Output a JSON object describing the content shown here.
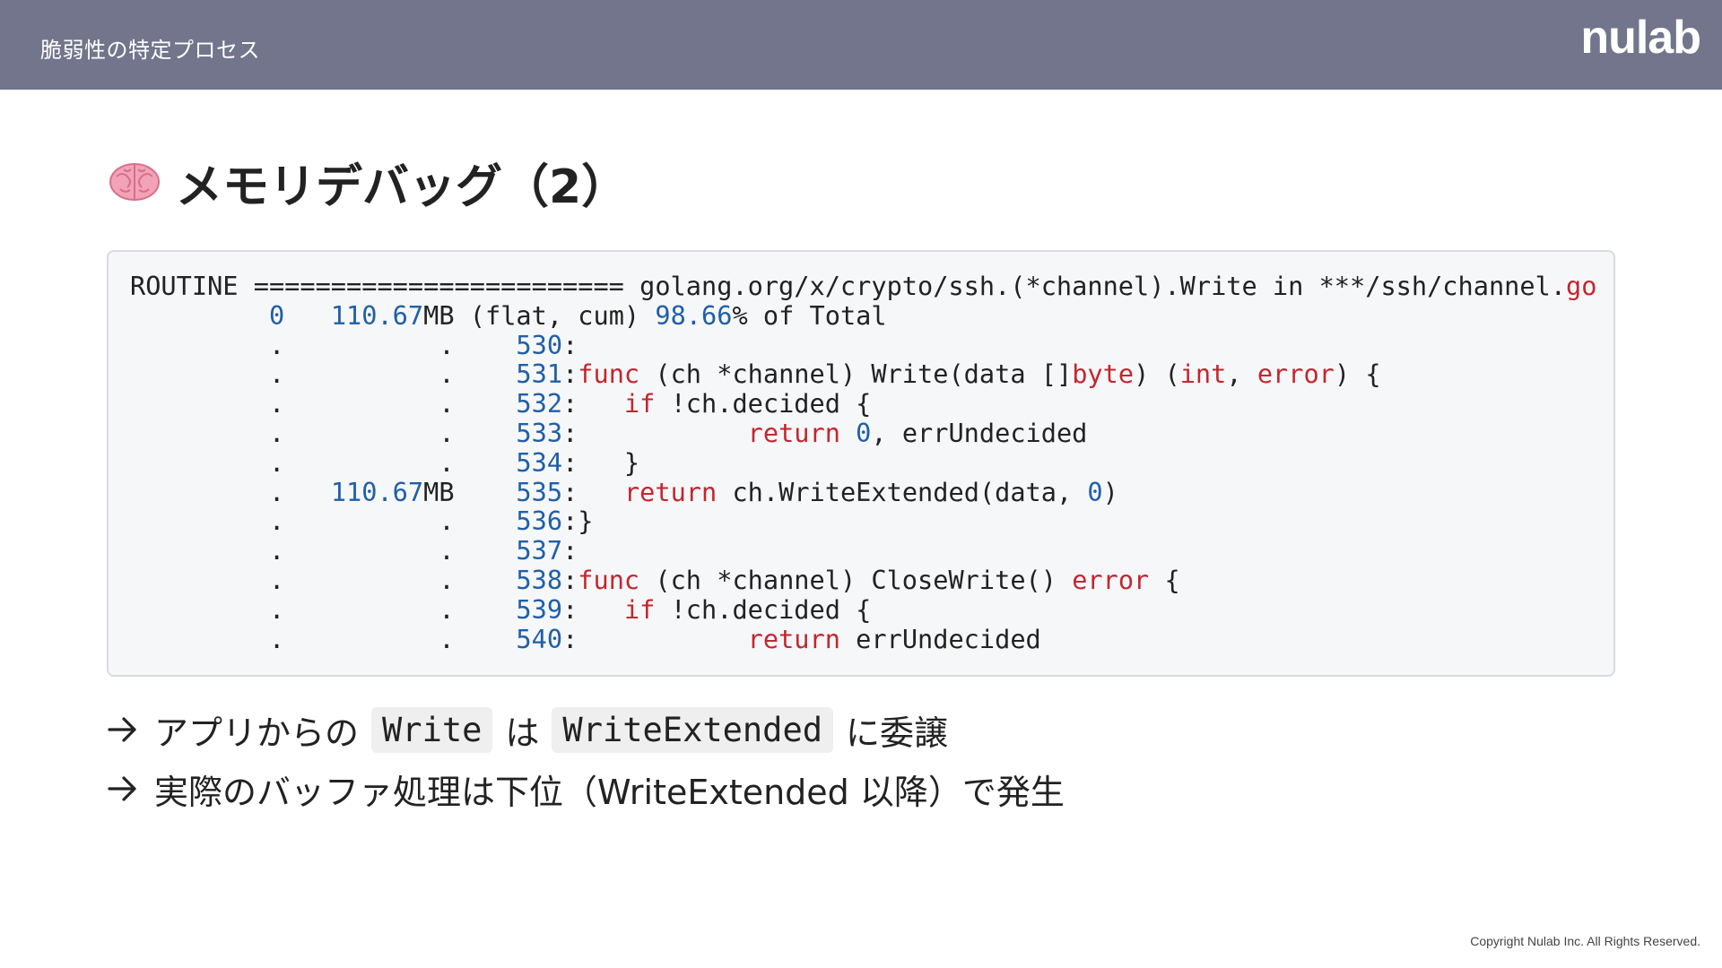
{
  "header": {
    "section_title": "脆弱性の特定プロセス",
    "logo_text": "nulab"
  },
  "title": {
    "icon": "brain-icon",
    "text": "メモリデバッグ（2）"
  },
  "code": {
    "routine": {
      "label": "ROUTINE",
      "separator": "========================",
      "path": "golang.org/x/crypto/ssh.(*channel).Write in ***/ssh/channel.",
      "ext": "go"
    },
    "summary": {
      "flat": "0",
      "cum_value": "110.67",
      "cum_unit": "MB",
      "label": "(flat, cum)",
      "percent": "98.66",
      "percent_suffix": "% of Total"
    },
    "lines": [
      {
        "flat": ".",
        "cum": ".",
        "cum_unit": "",
        "num": "530",
        "segments": []
      },
      {
        "flat": ".",
        "cum": ".",
        "cum_unit": "",
        "num": "531",
        "segments": [
          {
            "t": "func",
            "c": "k"
          },
          {
            "t": " (ch *channel) Write(data []",
            "c": ""
          },
          {
            "t": "byte",
            "c": "k"
          },
          {
            "t": ") (",
            "c": ""
          },
          {
            "t": "int",
            "c": "k"
          },
          {
            "t": ", ",
            "c": ""
          },
          {
            "t": "error",
            "c": "k"
          },
          {
            "t": ") {",
            "c": ""
          }
        ]
      },
      {
        "flat": ".",
        "cum": ".",
        "cum_unit": "",
        "num": "532",
        "segments": [
          {
            "t": "   ",
            "c": ""
          },
          {
            "t": "if",
            "c": "k"
          },
          {
            "t": " !ch.decided {",
            "c": ""
          }
        ]
      },
      {
        "flat": ".",
        "cum": ".",
        "cum_unit": "",
        "num": "533",
        "segments": [
          {
            "t": "           ",
            "c": ""
          },
          {
            "t": "return",
            "c": "k"
          },
          {
            "t": " ",
            "c": ""
          },
          {
            "t": "0",
            "c": "n"
          },
          {
            "t": ", errUndecided",
            "c": ""
          }
        ]
      },
      {
        "flat": ".",
        "cum": ".",
        "cum_unit": "",
        "num": "534",
        "segments": [
          {
            "t": "   }",
            "c": ""
          }
        ]
      },
      {
        "flat": ".",
        "cum": "110.67",
        "cum_unit": "MB",
        "num": "535",
        "segments": [
          {
            "t": "   ",
            "c": ""
          },
          {
            "t": "return",
            "c": "k"
          },
          {
            "t": " ch.WriteExtended(data, ",
            "c": ""
          },
          {
            "t": "0",
            "c": "n"
          },
          {
            "t": ")",
            "c": ""
          }
        ]
      },
      {
        "flat": ".",
        "cum": ".",
        "cum_unit": "",
        "num": "536",
        "segments": [
          {
            "t": "}",
            "c": ""
          }
        ]
      },
      {
        "flat": ".",
        "cum": ".",
        "cum_unit": "",
        "num": "537",
        "segments": []
      },
      {
        "flat": ".",
        "cum": ".",
        "cum_unit": "",
        "num": "538",
        "segments": [
          {
            "t": "func",
            "c": "k"
          },
          {
            "t": " (ch *channel) CloseWrite() ",
            "c": ""
          },
          {
            "t": "error",
            "c": "k"
          },
          {
            "t": " {",
            "c": ""
          }
        ]
      },
      {
        "flat": ".",
        "cum": ".",
        "cum_unit": "",
        "num": "539",
        "segments": [
          {
            "t": "   ",
            "c": ""
          },
          {
            "t": "if",
            "c": "k"
          },
          {
            "t": " !ch.decided {",
            "c": ""
          }
        ]
      },
      {
        "flat": ".",
        "cum": ".",
        "cum_unit": "",
        "num": "540",
        "segments": [
          {
            "t": "           ",
            "c": ""
          },
          {
            "t": "return",
            "c": "k"
          },
          {
            "t": " errUndecided",
            "c": ""
          }
        ]
      }
    ]
  },
  "bullets": [
    {
      "arrow": "→",
      "text_before": "アプリからの",
      "code1": "Write",
      "text_middle": "は",
      "code2": "WriteExtended",
      "text_after": "に委譲"
    },
    {
      "arrow": "→",
      "text": "実際のバッファ処理は下位（WriteExtended 以降）で発生"
    }
  ],
  "footer": {
    "copyright": "Copyright  Nulab Inc. All Rights Reserved."
  },
  "colors": {
    "header_bg": "#72758b",
    "number": "#1f5fa8",
    "keyword": "#c4262e",
    "code_bg": "#f6f7f9"
  }
}
